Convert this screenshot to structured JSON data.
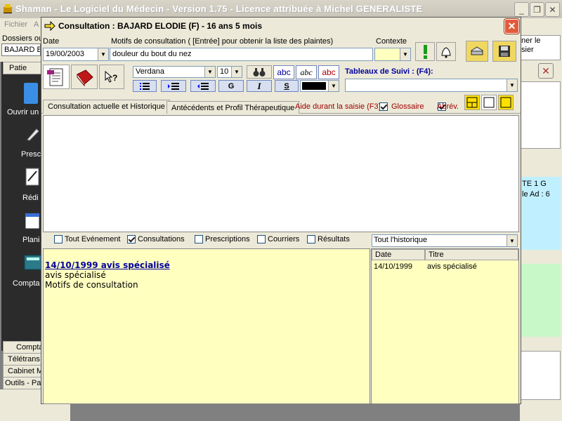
{
  "app": {
    "title": "Shaman - Le Logiciel du Médecin - Version 1.75 - Licence attribuée à Michel GENERALISTE",
    "menu": [
      "Fichier",
      "A"
    ]
  },
  "background": {
    "dossiers_label": "Dossiers ou",
    "patient_field": "BAJARD E",
    "right_snippet": [
      "ner le",
      "sier"
    ],
    "right_panel_texts": [
      "TE 1 G",
      "le Ad : 6"
    ],
    "sidebar_header": "Patie",
    "sidebar_items": [
      "Ouvrir un",
      "Presc",
      "Rédi",
      "Plani",
      "Compta"
    ],
    "bottom_buttons": [
      "Compta",
      "Télétrans",
      "Cabinet M",
      "Outils - Par"
    ]
  },
  "dialog": {
    "title": "Consultation : BAJARD ELODIE (F) -  16 ans 5 mois",
    "date_label": "Date",
    "date_value": "19/00/2003",
    "motifs_label": "Motifs de consultation ( [Entrée]  pour obtenir la liste des plaintes)",
    "motifs_value": "douleur du bout du nez",
    "contexte_label": "Contexte",
    "font_name": "Verdana",
    "font_size": "10",
    "format_bold": "G",
    "format_italic": "I",
    "format_underline": "S",
    "spell_labels": [
      "abc",
      "abc",
      "abc"
    ],
    "tableaux_label": "Tableaux de Suivi : (F4):",
    "tabs": [
      "Consultation actuelle et Historique",
      "Antécédents et Profil Thérapeutique"
    ],
    "aide_label": "Aide durant la saisie (F3):",
    "glossaire_label": "Glossaire",
    "abrev_label": "Abrév.",
    "filters": [
      {
        "label": "Tout Evénement",
        "checked": false
      },
      {
        "label": "Consultations",
        "checked": true
      },
      {
        "label": "Prescriptions",
        "checked": false
      },
      {
        "label": "Courriers",
        "checked": false
      },
      {
        "label": "Résultats",
        "checked": false
      }
    ],
    "history_select": "Tout l'historique",
    "history_entry": {
      "link": "14/10/1999 avis spécialisé",
      "line1": "avis spécialisé",
      "line2": "Motifs de consultation"
    },
    "list_headers": [
      "Date",
      "Titre"
    ],
    "list_rows": [
      {
        "date": "14/10/1999",
        "titre": "avis spécialisé"
      }
    ]
  },
  "colors": {
    "accent_blue": "#0000a0",
    "yellow_panel": "#ffffc0",
    "close_red": "#e35b3a"
  }
}
